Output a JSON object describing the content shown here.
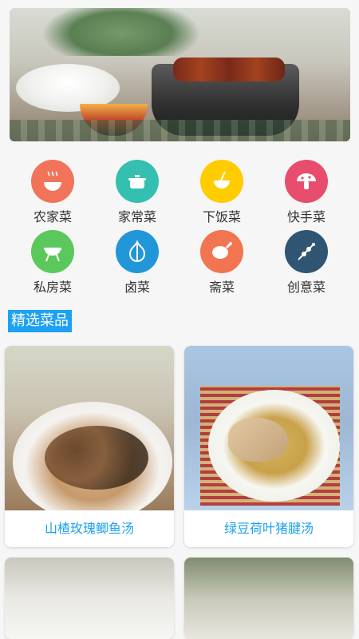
{
  "banner": {
    "icon": "food-photo"
  },
  "categories": [
    {
      "label": "农家菜",
      "icon": "soup-bowl-icon",
      "color": "#f0735a"
    },
    {
      "label": "家常菜",
      "icon": "cooking-pot-icon",
      "color": "#35bfb0"
    },
    {
      "label": "下饭菜",
      "icon": "rice-bowl-icon",
      "color": "#ffcc00"
    },
    {
      "label": "快手菜",
      "icon": "mushroom-icon",
      "color": "#e74d6c"
    },
    {
      "label": "私房菜",
      "icon": "bbq-grill-icon",
      "color": "#5bc85b"
    },
    {
      "label": "卤菜",
      "icon": "garlic-icon",
      "color": "#2196d8"
    },
    {
      "label": "斋菜",
      "icon": "chicken-leg-icon",
      "color": "#f07550"
    },
    {
      "label": "创意菜",
      "icon": "skewer-icon",
      "color": "#2f5573"
    }
  ],
  "section": {
    "title": "精选菜品"
  },
  "dishes": [
    {
      "title": "山楂玫瑰鲫鱼汤"
    },
    {
      "title": "绿豆荷叶猪腱汤"
    },
    {
      "title": ""
    },
    {
      "title": ""
    }
  ]
}
